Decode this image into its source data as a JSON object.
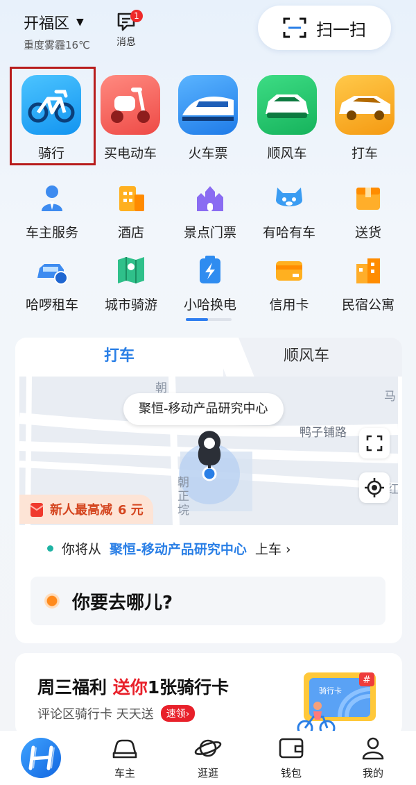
{
  "header": {
    "location": "开福区",
    "weather": "重度雾霾16℃",
    "messages_label": "消息",
    "messages_badge": "1",
    "scan_label": "扫一扫"
  },
  "main_services": [
    {
      "label": "骑行",
      "icon": "bicycle-icon"
    },
    {
      "label": "买电动车",
      "icon": "electric-scooter-icon"
    },
    {
      "label": "火车票",
      "icon": "train-icon"
    },
    {
      "label": "顺风车",
      "icon": "carpool-car-icon"
    },
    {
      "label": "打车",
      "icon": "taxi-icon"
    }
  ],
  "services_row1": [
    {
      "label": "车主服务",
      "icon": "driver-icon"
    },
    {
      "label": "酒店",
      "icon": "hotel-icon"
    },
    {
      "label": "景点门票",
      "icon": "castle-icon"
    },
    {
      "label": "有哈有车",
      "icon": "mascot-icon"
    },
    {
      "label": "送货",
      "icon": "box-icon"
    }
  ],
  "services_row2": [
    {
      "label": "哈啰租车",
      "icon": "rental-car-icon"
    },
    {
      "label": "城市骑游",
      "icon": "map-icon"
    },
    {
      "label": "小哈换电",
      "icon": "battery-icon"
    },
    {
      "label": "信用卡",
      "icon": "credit-card-icon"
    },
    {
      "label": "民宿公寓",
      "icon": "homestay-icon"
    }
  ],
  "ride_card": {
    "tab_active": "打车",
    "tab_inactive": "顺风车",
    "map_location_label": "聚恒-移动产品研究中心",
    "map_streets": [
      "朝",
      "马",
      "鸭子铺路",
      "朝",
      "正",
      "垸",
      "红"
    ],
    "promo_text": "新人最高减",
    "promo_amount": "6 元",
    "pickup_prefix": "你将从",
    "pickup_place": "聚恒-移动产品研究中心",
    "pickup_suffix": "上车 ›",
    "destination_placeholder": "你要去哪儿?"
  },
  "promo_banner": {
    "title_prefix": "周三福利",
    "title_highlight": "送你",
    "title_suffix": "1张骑行卡",
    "subtitle": "评论区骑行卡 天天送",
    "button_label": "速领›",
    "card_label": "骑行卡"
  },
  "bottom_nav": [
    {
      "label": "",
      "icon": "hello-logo-icon"
    },
    {
      "label": "车主",
      "icon": "car-outline-icon"
    },
    {
      "label": "逛逛",
      "icon": "planet-icon"
    },
    {
      "label": "钱包",
      "icon": "wallet-icon"
    },
    {
      "label": "我的",
      "icon": "user-icon"
    }
  ],
  "colors": {
    "accent": "#2a7fe6",
    "highlight_border": "#b81c1c",
    "promo_red": "#e8202a"
  }
}
